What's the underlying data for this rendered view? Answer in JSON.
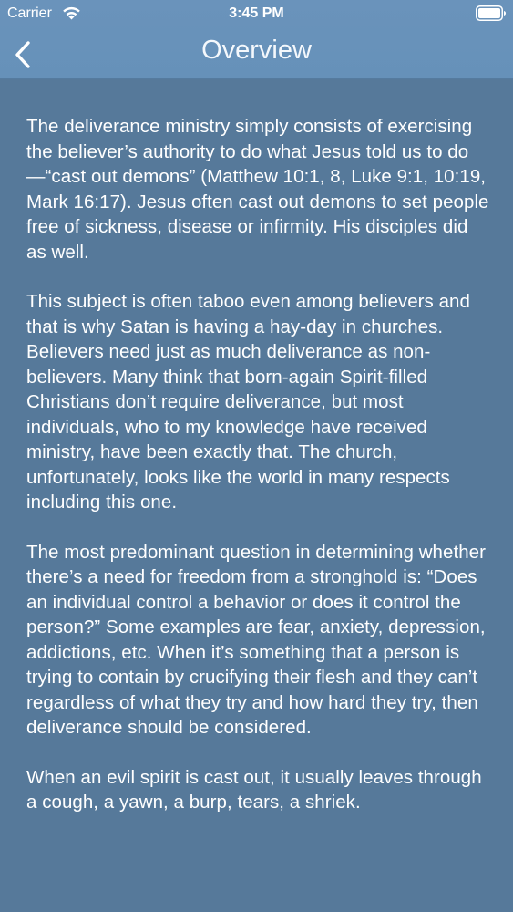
{
  "status_bar": {
    "carrier": "Carrier",
    "time": "3:45 PM",
    "wifi_icon": "wifi-icon",
    "battery_icon": "battery-full-icon"
  },
  "nav_bar": {
    "title": "Overview",
    "back_icon": "chevron-left-icon"
  },
  "colors": {
    "nav_background": "#6a93bb",
    "page_background": "#56799a",
    "text": "#ffffff"
  },
  "article": {
    "paragraphs": [
      "The deliverance ministry simply consists of exercising the believer’s authority to do what Jesus told us to do—“cast out demons” (Matthew 10:1, 8, Luke 9:1, 10:19, Mark 16:17). Jesus often cast out demons to set people free of sickness, disease or infirmity. His disciples did as well.",
      "This subject is often taboo even among believers and that is why Satan is having a hay-day in churches. Believers need just as much deliverance as non-believers. Many think that born-again Spirit-filled Christians don’t require deliverance, but most individuals, who to my knowledge have received ministry, have been exactly that. The church, unfortunately, looks like the world in many respects including this one.",
      "The most predominant question in determining whether there’s a need for freedom from a stronghold is: “Does an individual control a behavior or does it control the person?” Some examples are fear, anxiety, depression, addictions, etc. When it’s something that a person is trying to contain by crucifying their flesh and they can’t regardless of what they try and how hard they try, then deliverance should be considered.",
      "When an evil spirit is cast out, it usually leaves through a cough, a yawn, a burp, tears, a shriek."
    ]
  }
}
